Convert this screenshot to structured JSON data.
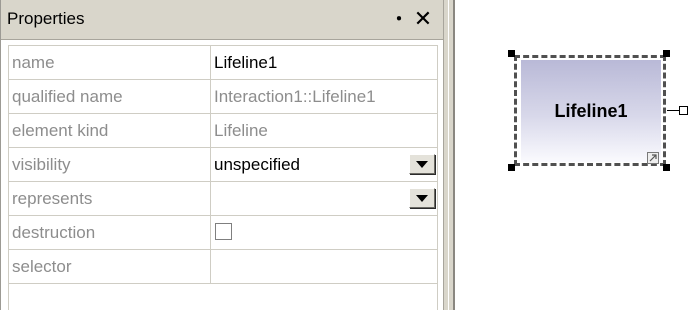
{
  "panel": {
    "title": "Properties",
    "pin_icon": "pin-icon",
    "close_icon": "close-icon"
  },
  "properties": [
    {
      "label": "name",
      "value": "Lifeline1",
      "kind": "text"
    },
    {
      "label": "qualified name",
      "value": "Interaction1::Lifeline1",
      "kind": "readonly"
    },
    {
      "label": "element kind",
      "value": "Lifeline",
      "kind": "readonly"
    },
    {
      "label": "visibility",
      "value": "unspecified",
      "kind": "dropdown"
    },
    {
      "label": "represents",
      "value": "",
      "kind": "dropdown"
    },
    {
      "label": "destruction",
      "value": false,
      "kind": "checkbox"
    },
    {
      "label": "selector",
      "value": "",
      "kind": "text"
    }
  ],
  "diagram": {
    "lifeline_name": "Lifeline1",
    "colors": {
      "fill_top": "#b9b9d7",
      "fill_bottom": "#fafafe",
      "selection": "#505050"
    }
  }
}
